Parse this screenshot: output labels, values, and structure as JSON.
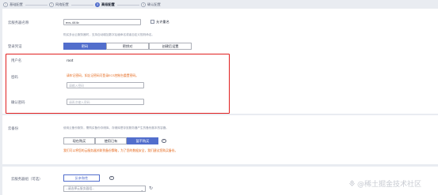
{
  "steps": [
    {
      "num": "1",
      "label": "基础配置",
      "active": false
    },
    {
      "num": "2",
      "label": "网络配置",
      "active": false
    },
    {
      "num": "3",
      "label": "高级配置",
      "active": true
    },
    {
      "num": "4",
      "label": "确认配置",
      "active": false
    }
  ],
  "server_name": {
    "label": "云服务器名称",
    "value": "ecs-444c",
    "allow_duplicate": "允许重名",
    "hint": "购买多台云服务器时，支持自动增加数字后缀命名或者自定义规则命名。"
  },
  "login": {
    "label": "登录凭证",
    "options": [
      "密码",
      "密钥对",
      "创建后设置"
    ],
    "selected": "密码"
  },
  "username": {
    "label": "用户名",
    "value": "root"
  },
  "password": {
    "label": "密码",
    "error": "请牢记密码，如忘记密码可登录ECS控制台重置密码。",
    "placeholder": "请输入密码"
  },
  "confirm_password": {
    "label": "确认密码",
    "placeholder": "请再次输入密码"
  },
  "backup": {
    "label": "云备份",
    "hint": "使用云备份服务，需购买备份存储库，存储库是存放服务器产生的备份副本的容器。",
    "options": [
      "现在购买",
      "使用已有",
      "暂不购买"
    ],
    "selected": "暂不购买",
    "warning": "我们可以将您的云服务器关联到备份策略，为了您的数据安全，我们建议您购买备份。"
  },
  "group": {
    "label": "云服务器组（可选）",
    "button": "反亲和性",
    "select_placeholder": "--请选择云服务器组--"
  },
  "watermark": "@稀土掘金技术社区",
  "colors": {
    "primary": "#526ecc",
    "error": "#e5671a",
    "highlight": "#e01f1f"
  }
}
